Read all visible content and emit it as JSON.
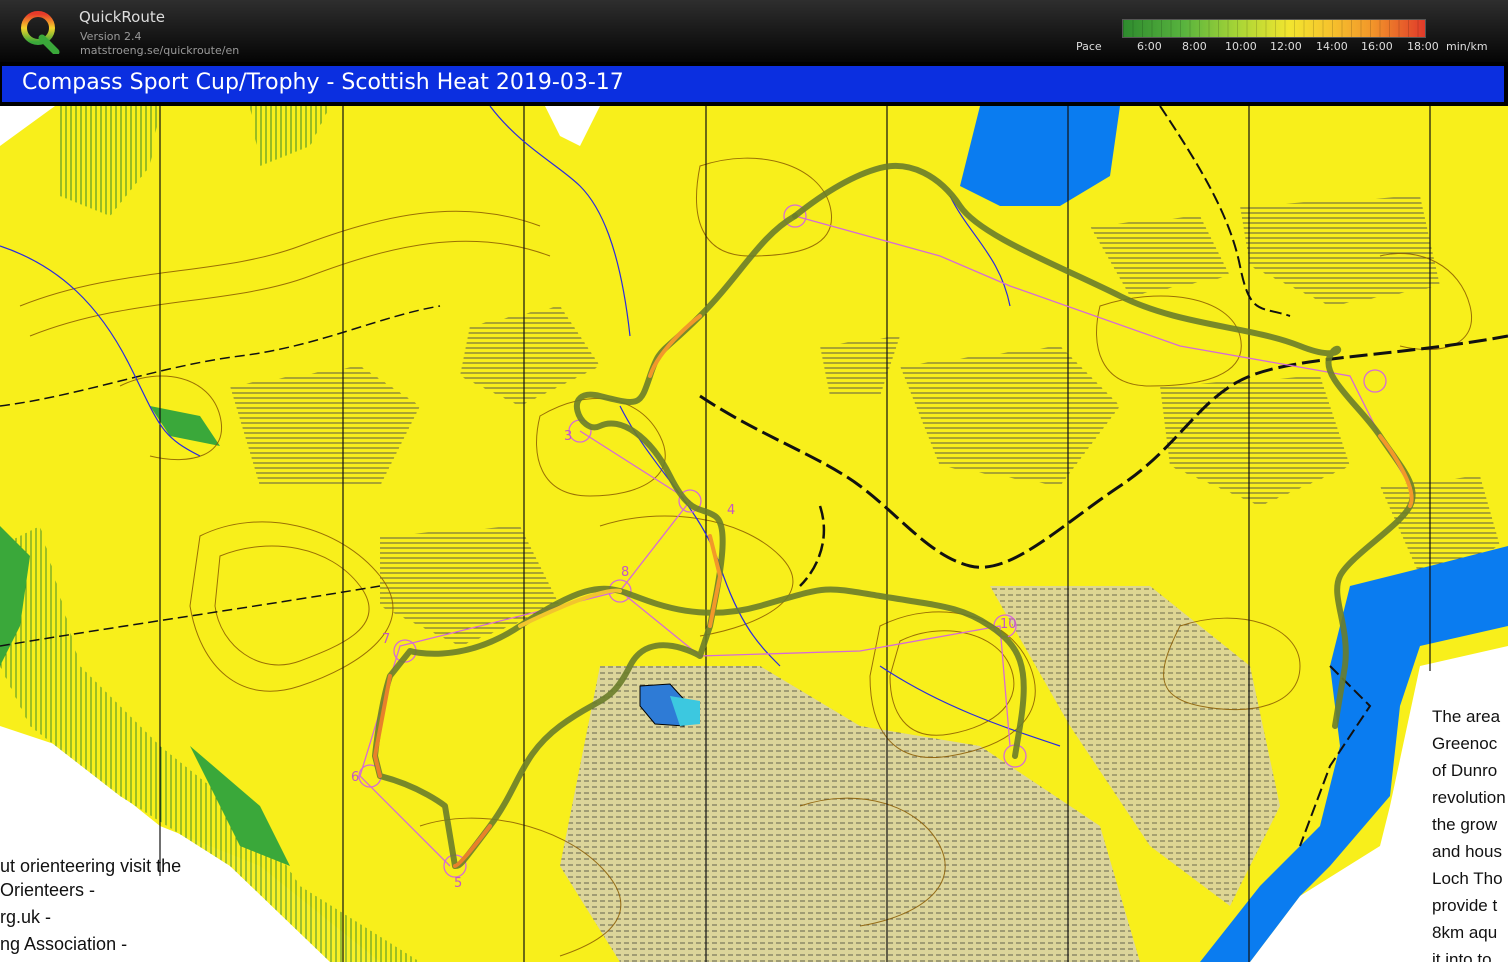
{
  "app": {
    "name": "QuickRoute",
    "version": "Version 2.4",
    "url": "matstroeng.se/quickroute/en"
  },
  "pace": {
    "label": "Pace",
    "ticks": [
      "6:00",
      "8:00",
      "10:00",
      "12:00",
      "14:00",
      "16:00",
      "18:00",
      "min/km"
    ],
    "colors": [
      "#2e8b2e",
      "#58b33e",
      "#a8d536",
      "#f2e52f",
      "#f6c52d",
      "#f2982a",
      "#e03a2a"
    ]
  },
  "title": "Compass Sport Cup/Trophy - Scottish Heat 2019-03-17",
  "map": {
    "colors": {
      "open_land": "#f8ef1b",
      "water": "#0a7cf0",
      "route": "#6a7d2a",
      "course": "#d66bd6",
      "contours": "#8a5a00"
    },
    "controls": [
      "3",
      "4",
      "5",
      "6",
      "7",
      "8",
      "10"
    ],
    "left_text": [
      "ut orienteering visit the",
      "Orienteers -",
      "rg.uk -",
      "ng Association -"
    ],
    "right_text": [
      "The area",
      "Greenoc",
      "of Dunro",
      "revolution",
      "the grow",
      "and hous",
      "Loch Tho",
      "provide t",
      "8km aqu",
      "it into to"
    ]
  }
}
